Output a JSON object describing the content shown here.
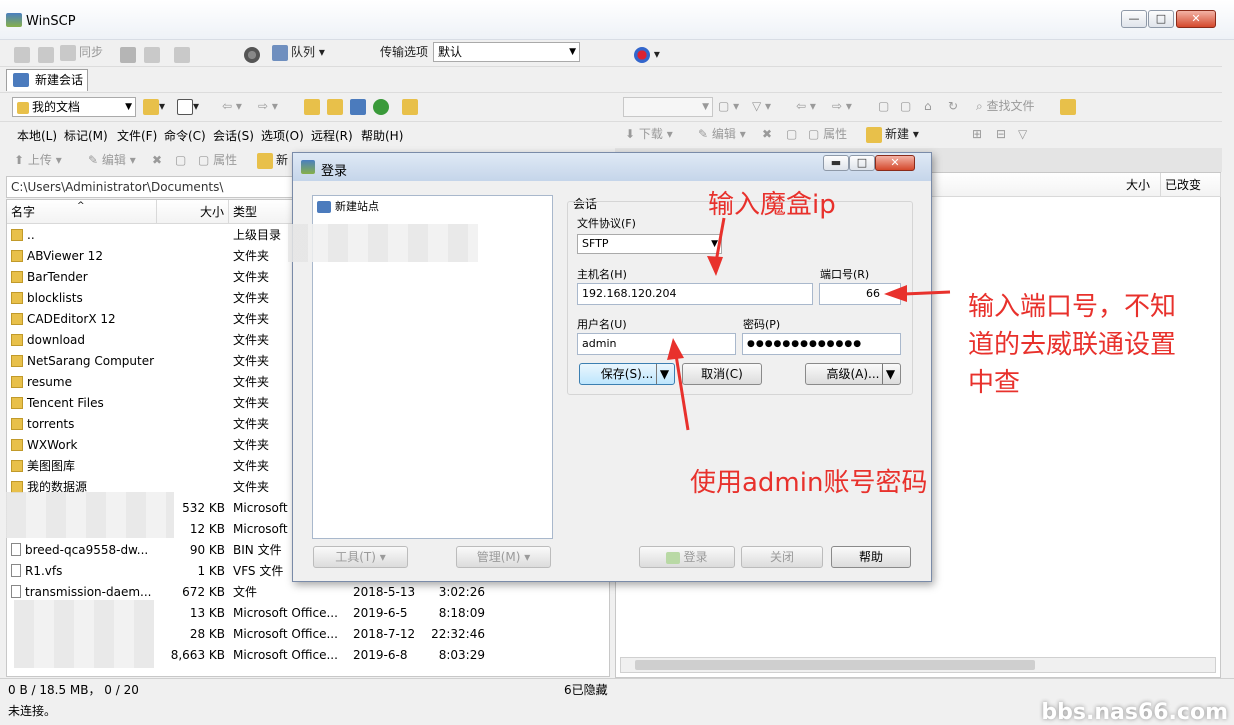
{
  "window": {
    "title": "WinSCP",
    "min": "—",
    "max": "□",
    "close": "✕"
  },
  "toolbar1": {
    "sync": "同步",
    "queue": "队列",
    "transfer_label": "传输选项",
    "transfer_value": "默认"
  },
  "session_tab": "新建会话",
  "left": {
    "location": "我的文档",
    "menu": [
      "本地(L)",
      "标记(M)",
      "文件(F)",
      "命令(C)",
      "会话(S)",
      "选项(O)",
      "远程(R)",
      "帮助(H)"
    ],
    "actions": {
      "upload": "上传",
      "edit": "编辑",
      "props": "属性",
      "new": "新"
    },
    "path": "C:\\Users\\Administrator\\Documents\\",
    "columns": {
      "name": "名字",
      "size": "大小",
      "type": "类型"
    },
    "rows": [
      {
        "name": "..",
        "size": "",
        "type": "上级目录",
        "date": "",
        "time": ""
      },
      {
        "name": "ABViewer 12",
        "size": "",
        "type": "文件夹",
        "date": "",
        "time": ""
      },
      {
        "name": "BarTender",
        "size": "",
        "type": "文件夹",
        "date": "",
        "time": ""
      },
      {
        "name": "blocklists",
        "size": "",
        "type": "文件夹",
        "date": "",
        "time": ""
      },
      {
        "name": "CADEditorX 12",
        "size": "",
        "type": "文件夹",
        "date": "",
        "time": ""
      },
      {
        "name": "download",
        "size": "",
        "type": "文件夹",
        "date": "",
        "time": ""
      },
      {
        "name": "NetSarang Computer",
        "size": "",
        "type": "文件夹",
        "date": "",
        "time": ""
      },
      {
        "name": "resume",
        "size": "",
        "type": "文件夹",
        "date": "",
        "time": ""
      },
      {
        "name": "Tencent Files",
        "size": "",
        "type": "文件夹",
        "date": "",
        "time": ""
      },
      {
        "name": "torrents",
        "size": "",
        "type": "文件夹",
        "date": "",
        "time": ""
      },
      {
        "name": "WXWork",
        "size": "",
        "type": "文件夹",
        "date": "",
        "time": ""
      },
      {
        "name": "美图图库",
        "size": "",
        "type": "文件夹",
        "date": "",
        "time": ""
      },
      {
        "name": "我的数据源",
        "size": "",
        "type": "文件夹",
        "date": "",
        "time": ""
      },
      {
        "name": "",
        "size": "532 KB",
        "type": "Microsoft",
        "date": "",
        "time": ""
      },
      {
        "name": "",
        "size": "12 KB",
        "type": "Microsoft",
        "date": "",
        "time": ""
      },
      {
        "name": "breed-qca9558-dw...",
        "size": "90 KB",
        "type": "BIN 文件",
        "date": "",
        "time": ""
      },
      {
        "name": "R1.vfs",
        "size": "1 KB",
        "type": "VFS 文件",
        "date": "",
        "time": ""
      },
      {
        "name": "transmission-daem...",
        "size": "672 KB",
        "type": "文件",
        "date": "2018-5-13",
        "time": "3:02:26"
      },
      {
        "name": "",
        "size": "13 KB",
        "type": "Microsoft Office...",
        "date": "2019-6-5",
        "time": "8:18:09"
      },
      {
        "name": "",
        "size": "28 KB",
        "type": "Microsoft Office...",
        "date": "2018-7-12",
        "time": "22:32:46"
      },
      {
        "name": "",
        "size": "8,663 KB",
        "type": "Microsoft Office...",
        "date": "2019-6-8",
        "time": "8:03:29"
      }
    ]
  },
  "right": {
    "actions": {
      "download": "下载",
      "edit": "编辑",
      "props": "属性",
      "new": "新建",
      "find": "查找文件"
    },
    "columns": {
      "size": "大小",
      "changed": "已改变"
    }
  },
  "status": {
    "left": "0 B / 18.5 MB， 0 / 20",
    "hidden": "6已隐藏",
    "conn": "未连接。"
  },
  "dialog": {
    "title": "登录",
    "site": "新建站点",
    "group": "会话",
    "protocol_label": "文件协议(F)",
    "protocol": "SFTP",
    "host_label": "主机名(H)",
    "host": "192.168.120.204",
    "port_label": "端口号(R)",
    "port": "66",
    "user_label": "用户名(U)",
    "user": "admin",
    "pass_label": "密码(P)",
    "pass": "●●●●●●●●●●●●●",
    "save": "保存(S)...",
    "cancel": "取消(C)",
    "advanced": "高级(A)...",
    "tools": "工具(T)",
    "manage": "管理(M)",
    "login": "登录",
    "close": "关闭",
    "help": "帮助"
  },
  "annotations": {
    "ip": "输入魔盒ip",
    "port_lines": [
      "输入端口号，不知",
      "道的去威联通设置",
      "中查"
    ],
    "account": "使用admin账号密码"
  },
  "watermark": "bbs.nas66.com"
}
